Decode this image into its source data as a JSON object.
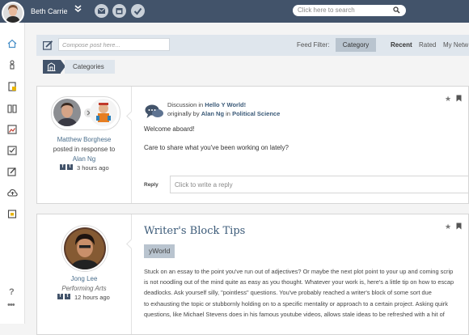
{
  "header": {
    "user_name": "Beth Carrie",
    "search_placeholder": "Click here to search"
  },
  "toolbar": {
    "compose_placeholder": "Compose post here...",
    "feed_filter_label": "Feed Filter:",
    "feed_filter_value": "Category",
    "tabs": [
      "Recent",
      "Rated",
      "My Netw"
    ]
  },
  "breadcrumb": {
    "current": "Categories"
  },
  "posts": [
    {
      "author": "Matthew Borghese",
      "context": "posted in response to",
      "response_to": "Alan Ng",
      "time": "3 hours ago",
      "discussion_prefix": "Discussion in",
      "discussion_name": "Hello Y World!",
      "originally_prefix": "originally by",
      "original_author": "Alan Ng",
      "in_word": "in",
      "original_category": "Political Science",
      "lines": [
        "Welcome aboard!",
        "Care to share what you've been working on lately?"
      ],
      "reply_label": "Reply",
      "reply_placeholder": "Click to write a reply"
    },
    {
      "author": "Jong Lee",
      "subtitle": "Performing Arts",
      "time": "12 hours ago",
      "title": "Writer's Block Tips",
      "tag": "yWorld",
      "paragraph": [
        "Stuck on an essay to the point you've run out of adjectives? Or maybe the next plot point to your up and coming scrip",
        "is not noodling out of the mind quite as easy as you thought. Whatever your work is, here's a little tip on how to escap",
        "deadlocks. Ask yourself silly, \"pointless\" questions. You've probably reached a writer's block of some sort due",
        "to exhausting the topic or stubbornly holding on to a specific mentality or approach to a certain project. Asking quirk",
        "questions, like Michael Stevens does in his famous youtube videos, allows stale ideas to be refreshed with a hit of"
      ]
    }
  ],
  "sidebar": {
    "help": "?",
    "more": "•••"
  },
  "colors": {
    "topbar": "#42536a",
    "link": "#3b5a78",
    "toolbar": "#dfe6ed",
    "chip": "#b9c4cf"
  }
}
